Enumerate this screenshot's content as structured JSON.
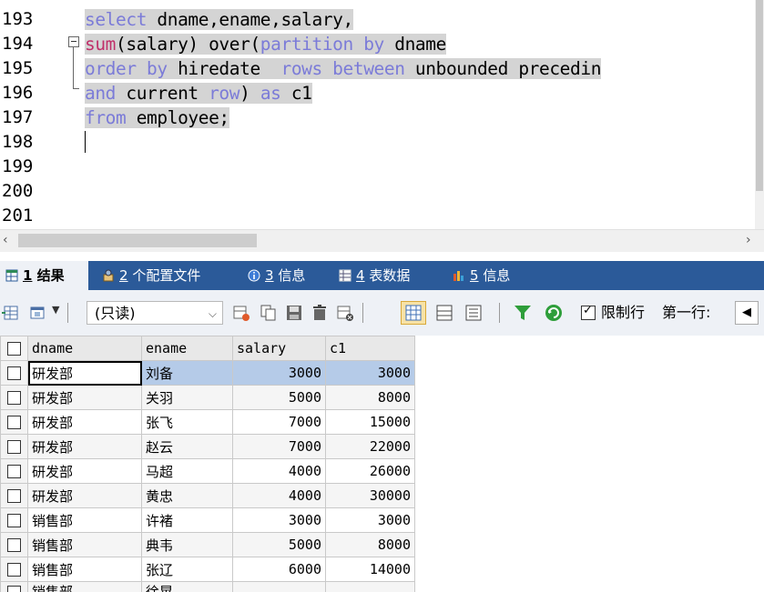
{
  "editor": {
    "line_numbers": [
      "193",
      "194",
      "195",
      "196",
      "197",
      "198",
      "199",
      "200",
      "201"
    ],
    "lines": [
      [
        {
          "t": "select",
          "c": "kw"
        },
        {
          "t": " dname,ename,salary,",
          "c": "ident"
        }
      ],
      [
        {
          "t": "sum",
          "c": "fn"
        },
        {
          "t": "(salary) over(",
          "c": "ident"
        },
        {
          "t": "partition by",
          "c": "kw"
        },
        {
          "t": " dname",
          "c": "ident"
        }
      ],
      [
        {
          "t": "order by",
          "c": "kw"
        },
        {
          "t": " hiredate  ",
          "c": "ident"
        },
        {
          "t": "rows between",
          "c": "kw"
        },
        {
          "t": " unbounded precedin",
          "c": "ident"
        }
      ],
      [
        {
          "t": "and",
          "c": "kw"
        },
        {
          "t": " current ",
          "c": "ident"
        },
        {
          "t": "row",
          "c": "kw"
        },
        {
          "t": ") ",
          "c": "ident"
        },
        {
          "t": "as",
          "c": "kw"
        },
        {
          "t": " c1",
          "c": "ident"
        }
      ],
      [
        {
          "t": "from",
          "c": "kw"
        },
        {
          "t": " employee;",
          "c": "ident"
        }
      ]
    ]
  },
  "tabs": [
    {
      "num": "1",
      "label": "结果",
      "icon": "result-grid-icon"
    },
    {
      "num": "2",
      "label": "个配置文件",
      "icon": "profile-icon"
    },
    {
      "num": "3",
      "label": "信息",
      "icon": "info-icon"
    },
    {
      "num": "4",
      "label": "表数据",
      "icon": "table-data-icon"
    },
    {
      "num": "5",
      "label": "信息",
      "icon": "info-icon"
    }
  ],
  "toolbar": {
    "mode_value": "(只读)",
    "limit_rows_label": "限制行",
    "first_row_label": "第一行:"
  },
  "grid": {
    "columns": [
      "dname",
      "ename",
      "salary",
      "c1"
    ],
    "rows": [
      [
        "研发部",
        "刘备",
        "3000",
        "3000"
      ],
      [
        "研发部",
        "关羽",
        "5000",
        "8000"
      ],
      [
        "研发部",
        "张飞",
        "7000",
        "15000"
      ],
      [
        "研发部",
        "赵云",
        "7000",
        "22000"
      ],
      [
        "研发部",
        "马超",
        "4000",
        "26000"
      ],
      [
        "研发部",
        "黄忠",
        "4000",
        "30000"
      ],
      [
        "销售部",
        "许褚",
        "3000",
        "3000"
      ],
      [
        "销售部",
        "典韦",
        "5000",
        "8000"
      ],
      [
        "销售部",
        "张辽",
        "6000",
        "14000"
      ],
      [
        "销售部",
        "徐晃",
        "",
        "",
        ""
      ]
    ]
  },
  "colors": {
    "tab_bar": "#2b5a99",
    "keyword": "#7b7bd8",
    "function": "#c0306a",
    "selection": "#d4d4d4",
    "selected_row": "#b5cbe8"
  }
}
